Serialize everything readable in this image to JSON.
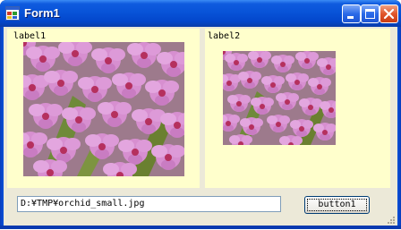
{
  "window": {
    "title": "Form1"
  },
  "titlebar_buttons": {
    "minimize": "minimize-icon",
    "maximize": "maximize-icon",
    "close": "close-icon"
  },
  "panels": {
    "left": {
      "label": "label1"
    },
    "right": {
      "label": "label2"
    }
  },
  "path_field": {
    "value": "D:¥TMP¥orchid_small.jpg"
  },
  "action_button": {
    "label": "button1"
  },
  "colors": {
    "titlebar": "#0853d8",
    "panel_background": "#ffffcc",
    "client_background": "#ece9d8",
    "flower_pink": "#d78fd0",
    "flower_center": "#b5305e",
    "leaf_green": "#6f8a3a"
  }
}
